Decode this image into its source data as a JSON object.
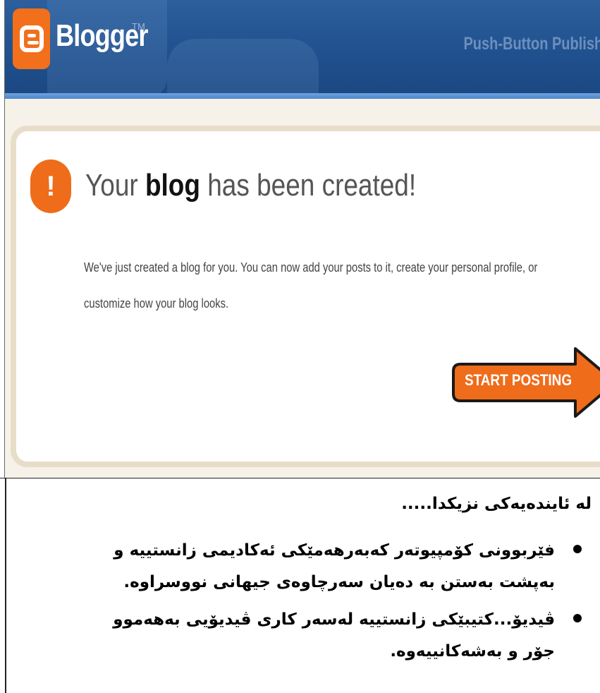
{
  "blogger": {
    "logo_text": "Blogger",
    "trademark": "TM",
    "tagline": "Push-Button Publish",
    "headline_pre": "Your",
    "headline_bold": "blog",
    "headline_post": "has been created!",
    "alert_glyph": "!",
    "body_line1": "We've just created a blog for you. You can now add your posts to it, create your personal profile, or",
    "body_line2": "customize how your blog looks.",
    "start_label": "START POSTING",
    "colors": {
      "header_blue": "#1f4f8c",
      "accent_orange": "#f26f1b",
      "card_border": "#e8ddc9"
    }
  },
  "document": {
    "intro": "له ئاینده‌یه‌کی نزیکدا.....",
    "bullets": [
      {
        "line1": "فێربوونی کۆمپیوتەر کەبەرهەمێکی ئەکادیمی زانستییە و",
        "line2": "بەپشت بەستن بە دەیان سەرچاوەی جیهانی نووسراوە."
      },
      {
        "line1": "ڤیدیۆ...کتیبێکی زانستییە لەسەر کاری ڤیدیۆیی بەهەموو",
        "line2": "جۆر و بەشەکانییەوە."
      }
    ]
  }
}
